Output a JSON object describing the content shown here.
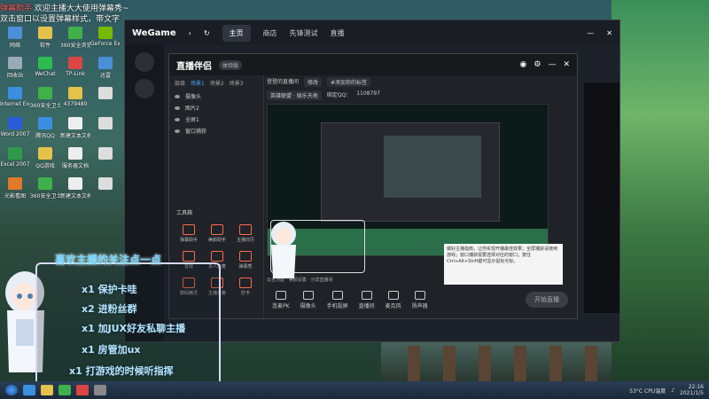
{
  "overlay_top": {
    "line1_tag": "弹幕助手",
    "line1_text": "欢迎主播大大使用弹幕秀~",
    "line2_text": "双击窗口以设置弹幕样式，带文字"
  },
  "desktop_icons": [
    {
      "label": "网络",
      "color": "#4a8fd8"
    },
    {
      "label": "软件",
      "color": "#e5c24a"
    },
    {
      "label": "360安全浏览器",
      "color": "#3fb04a"
    },
    {
      "label": "GeForce Experience",
      "color": "#76b900"
    },
    {
      "label": "回收站",
      "color": "#9ab"
    },
    {
      "label": "WeChat",
      "color": "#2dbb4f"
    },
    {
      "label": "TP-Link",
      "color": "#d44"
    },
    {
      "label": "迅雷",
      "color": "#4a8fd8"
    },
    {
      "label": "Internet Explorer",
      "color": "#3a8fe0"
    },
    {
      "label": "360安全卫士",
      "color": "#3fb04a"
    },
    {
      "label": "4379480",
      "color": "#e5c24a"
    },
    {
      "label": "",
      "color": "#ddd"
    },
    {
      "label": "Word 2007",
      "color": "#2a5bd8"
    },
    {
      "label": "腾讯QQ",
      "color": "#3a8fe0"
    },
    {
      "label": "新建文本文档",
      "color": "#eee"
    },
    {
      "label": "",
      "color": "#ddd"
    },
    {
      "label": "Excel 2007",
      "color": "#2f9a4a"
    },
    {
      "label": "QQ游戏",
      "color": "#e5c24a"
    },
    {
      "label": "服务器文档",
      "color": "#eee"
    },
    {
      "label": "",
      "color": "#ddd"
    },
    {
      "label": "光影看图",
      "color": "#e07a2a"
    },
    {
      "label": "360安全卫士",
      "color": "#3fb04a"
    },
    {
      "label": "新建文本文档",
      "color": "#eee"
    },
    {
      "label": "",
      "color": "#ddd"
    }
  ],
  "wegame": {
    "logo": "WeGame",
    "tabs": [
      "主页",
      "商店",
      "先锋测试",
      "直播"
    ],
    "active_tab": "主页"
  },
  "live": {
    "logo": "直播伴侣",
    "version": "体验版",
    "scene_tabs": [
      "层级",
      "场景1",
      "场景2",
      "场景3"
    ],
    "sources": [
      "摄像头",
      "图片2",
      "全屏1",
      "窗口捕获"
    ],
    "tools_title": "工具箱",
    "tools": [
      "弹幕助手",
      "美颜助手",
      "主播日历",
      "音效",
      "多人连麦",
      "弹幕秀",
      "数码精灵",
      "主播任务",
      "打卡"
    ],
    "room_title": "登登的直播间",
    "room_edit": "修改",
    "room_tag": "#添加你的标签",
    "category": "英雄联盟 · 娱乐天地",
    "qq_label": "绑定QQ：",
    "qq_value": "1108797",
    "tip_text": "做好主播指南，让你实现开播最佳效果；全屏捕获请使用游戏；窗口捕获需要选择对应的窗口；按住Ctrl+Alt+Shift键可显示鼠标光标。",
    "bottom_buttons": [
      "连麦PK",
      "摄像头",
      "手机投屏",
      "直播间",
      "麦克风",
      "扬声器"
    ],
    "start_button": "开始直播",
    "status": "云台功能 · 美颜设置 · 分享直播间"
  },
  "notice": {
    "title": "喜欢主播的关注点一点",
    "lines": [
      "x1 保护卡哇",
      "x2 进粉丝群",
      "x1 加JUX好友私聊主播",
      "x1 房管加ux",
      "x1 打游戏的时候听指挥"
    ]
  },
  "taskbar": {
    "temp": "53°C",
    "cpu": "CPU温度",
    "time": "22:16",
    "date": "2021/1/5"
  }
}
